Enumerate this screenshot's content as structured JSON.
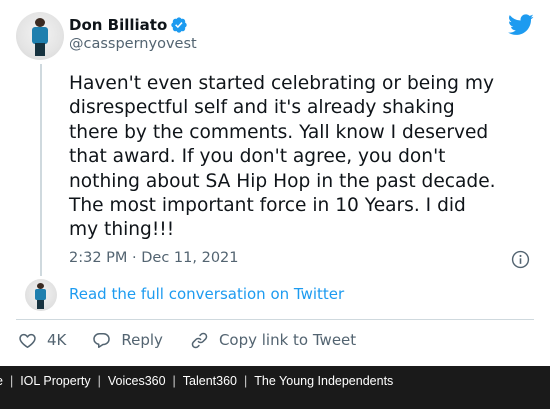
{
  "tweet": {
    "display_name": "Don Billiato",
    "handle": "@casspernyovest",
    "verified": true,
    "text_lines": [
      "Haven't even started celebrating or being my",
      "disrespectful self and it's already shaking",
      "there by the comments. Yall know I deserved",
      "that award. If you don't agree, you don't",
      "nothing about SA Hip Hop in the past decade.",
      "The most important force in 10 Years. I did",
      "my thing!!!"
    ],
    "timestamp": "2:32 PM · Dec 11, 2021",
    "read_link": "Read the full conversation on Twitter",
    "actions": {
      "like_count": "4K",
      "reply_label": "Reply",
      "copy_label": "Copy link to Tweet"
    }
  },
  "bottom_bar": {
    "items": [
      {
        "label": "e"
      },
      {
        "label": "IOL Property"
      },
      {
        "label": "Voices360"
      },
      {
        "label": "Talent360"
      },
      {
        "label": "The Young Independents"
      }
    ],
    "separator": "|"
  },
  "colors": {
    "twitter_blue": "#1d9bf0",
    "muted_text": "#536471",
    "text": "#0f1419",
    "bar_background": "#1a1a1a"
  },
  "icons": [
    "verified-badge-icon",
    "twitter-bird-icon",
    "info-icon",
    "heart-icon",
    "reply-bubble-icon",
    "link-icon"
  ]
}
